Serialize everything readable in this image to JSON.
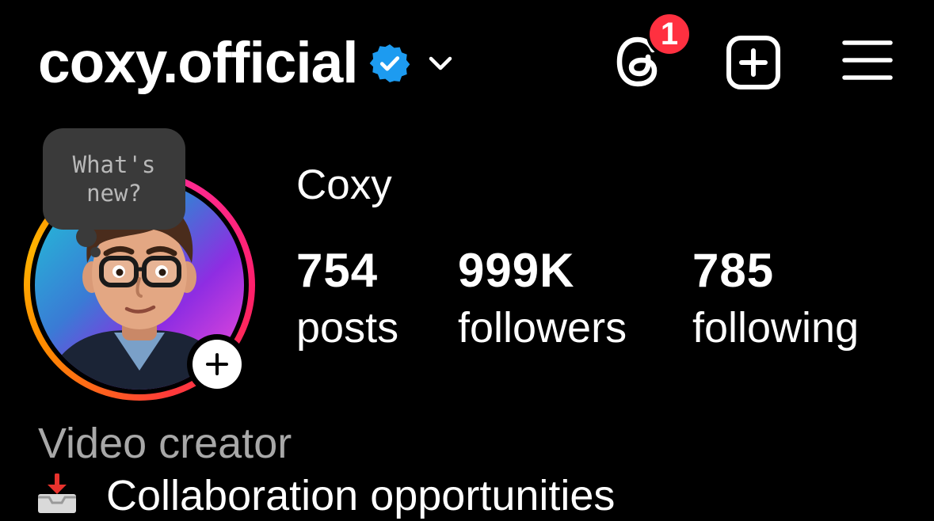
{
  "header": {
    "username": "coxy.official",
    "verified_icon": "verified-badge-icon",
    "dropdown_icon": "chevron-down-icon",
    "threads_icon": "threads-icon",
    "notification_count": "1",
    "create_icon": "plus-square-icon",
    "menu_icon": "hamburger-menu-icon"
  },
  "note": {
    "text": "What's\nnew?"
  },
  "profile": {
    "display_name": "Coxy",
    "avatar_icon": "cartoon-avatar",
    "add_story_icon": "plus-icon"
  },
  "stats": [
    {
      "count": "754",
      "label": "posts"
    },
    {
      "count": "999K",
      "label": "followers"
    },
    {
      "count": "785",
      "label": "following"
    }
  ],
  "bio": {
    "category": "Video creator",
    "line1_icon": "inbox-tray-icon",
    "line1_text": "Collaboration opportunities"
  },
  "colors": {
    "background": "#000000",
    "badge_red": "#ff3040",
    "verified_blue": "#1d9bf0",
    "bubble_gray": "#3a3a3a",
    "secondary_text": "#a8a8a8"
  }
}
